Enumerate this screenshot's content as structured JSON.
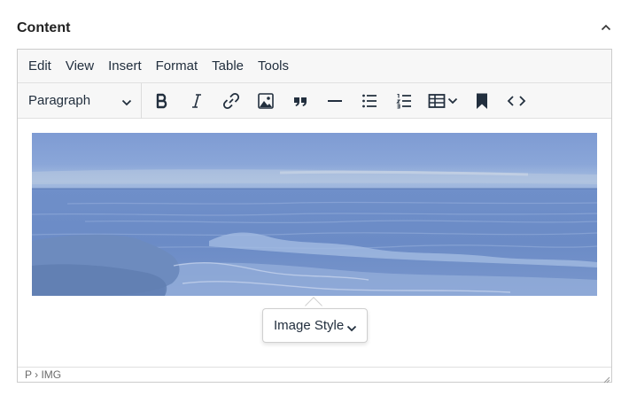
{
  "section": {
    "title": "Content"
  },
  "menubar": {
    "items": [
      "Edit",
      "View",
      "Insert",
      "Format",
      "Table",
      "Tools"
    ]
  },
  "toolbar": {
    "block_format": "Paragraph",
    "buttons": [
      "bold-icon",
      "italic-icon",
      "link-icon",
      "image-icon",
      "blockquote-icon",
      "horizontal-rule-icon",
      "bullet-list-icon",
      "numbered-list-icon",
      "table-icon",
      "bookmark-icon",
      "code-icon"
    ]
  },
  "popup": {
    "label": "Image Style"
  },
  "statusbar": {
    "path": "P › IMG"
  },
  "colors": {
    "text": "#222f3e",
    "toolbar_bg": "#f7f7f7",
    "border": "#cccccc",
    "image_tint": "#7f9bd1"
  }
}
